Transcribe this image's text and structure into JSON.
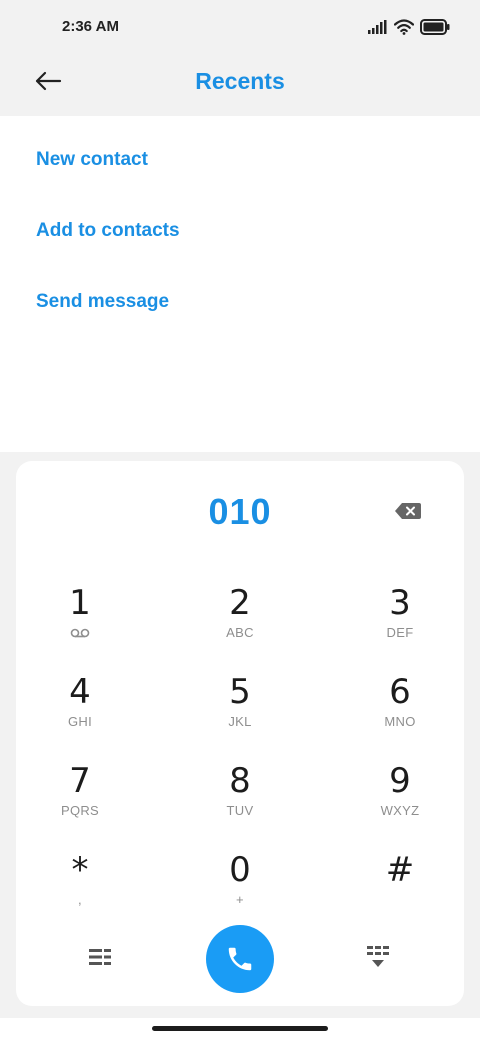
{
  "status_bar": {
    "time": "2:36 AM",
    "icons": [
      "signal-icon",
      "wifi-icon",
      "battery-icon"
    ]
  },
  "header": {
    "title": "Recents",
    "back_icon": "arrow-left-icon"
  },
  "options": [
    {
      "label": "New contact"
    },
    {
      "label": "Add to contacts"
    },
    {
      "label": "Send message"
    }
  ],
  "dialpad": {
    "number": "010",
    "keys": [
      {
        "digit": "1",
        "letters": ""
      },
      {
        "digit": "2",
        "letters": "ABC"
      },
      {
        "digit": "3",
        "letters": "DEF"
      },
      {
        "digit": "4",
        "letters": "GHI"
      },
      {
        "digit": "5",
        "letters": "JKL"
      },
      {
        "digit": "6",
        "letters": "MNO"
      },
      {
        "digit": "7",
        "letters": "PQRS"
      },
      {
        "digit": "8",
        "letters": "TUV"
      },
      {
        "digit": "9",
        "letters": "WXYZ"
      },
      {
        "digit": "*",
        "letters": ","
      },
      {
        "digit": "0",
        "letters": "+"
      },
      {
        "digit": "#",
        "letters": ""
      }
    ]
  },
  "colors": {
    "accent": "#1a8fe3",
    "call_button": "#1a9cf5",
    "background": "#f2f2f2",
    "card": "#ffffff"
  }
}
